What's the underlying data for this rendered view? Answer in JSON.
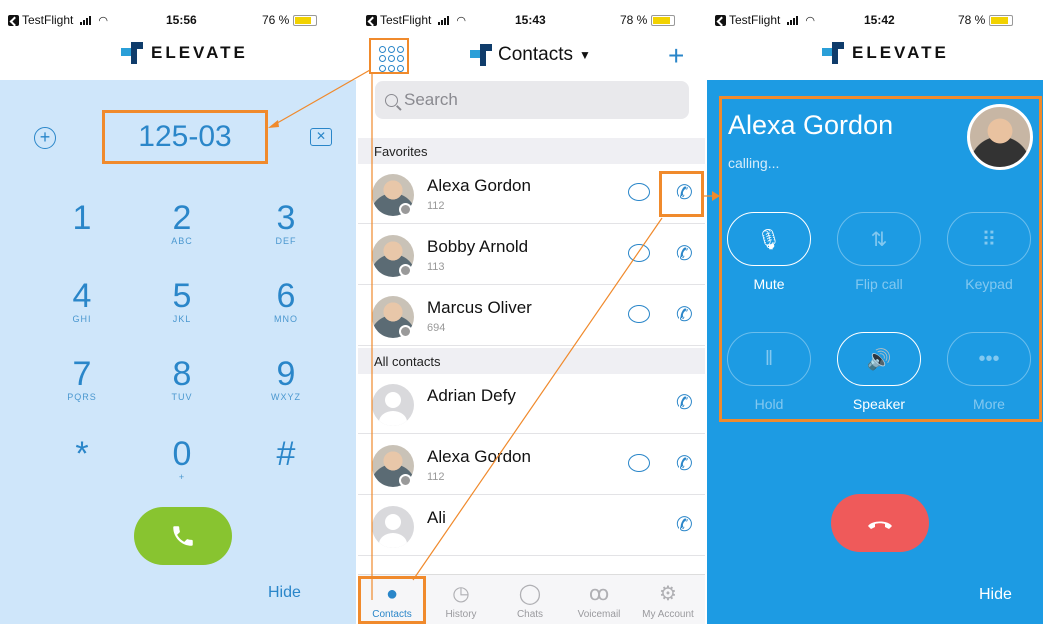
{
  "colors": {
    "accent": "#2a86c9",
    "highlight": "#f08a2c",
    "call_green": "#88c430",
    "hangup_red": "#ef5a5a",
    "call_bg": "#1d9be3"
  },
  "panels": [
    {
      "status": {
        "app": "TestFlight",
        "time": "15:56",
        "battery": "76 %",
        "battery_level": 0.76
      }
    },
    {
      "status": {
        "app": "TestFlight",
        "time": "15:43",
        "battery": "78 %",
        "battery_level": 0.78
      }
    },
    {
      "status": {
        "app": "TestFlight",
        "time": "15:42",
        "battery": "78 %",
        "battery_level": 0.78
      }
    }
  ],
  "brand": {
    "name": "ELEVATE"
  },
  "dialpad": {
    "number": "125-03",
    "keys": [
      {
        "digit": "1",
        "letters": ""
      },
      {
        "digit": "2",
        "letters": "ABC"
      },
      {
        "digit": "3",
        "letters": "DEF"
      },
      {
        "digit": "4",
        "letters": "GHI"
      },
      {
        "digit": "5",
        "letters": "JKL"
      },
      {
        "digit": "6",
        "letters": "MNO"
      },
      {
        "digit": "7",
        "letters": "PQRS"
      },
      {
        "digit": "8",
        "letters": "TUV"
      },
      {
        "digit": "9",
        "letters": "WXYZ"
      },
      {
        "digit": "*",
        "letters": ""
      },
      {
        "digit": "0",
        "letters": "+"
      },
      {
        "digit": "#",
        "letters": ""
      }
    ],
    "hide_label": "Hide"
  },
  "contacts": {
    "title": "Contacts",
    "search_placeholder": "Search",
    "favorites_label": "Favorites",
    "all_label": "All contacts",
    "favorites": [
      {
        "name": "Alexa Gordon",
        "ext": "112",
        "chat": true
      },
      {
        "name": "Bobby Arnold",
        "ext": "113",
        "chat": true
      },
      {
        "name": "Marcus Oliver",
        "ext": "694",
        "chat": true
      }
    ],
    "all": [
      {
        "name": "Adrian Defy",
        "ext": "",
        "chat": false
      },
      {
        "name": "Alexa Gordon",
        "ext": "112",
        "chat": true
      },
      {
        "name": "Ali",
        "ext": "",
        "chat": false
      }
    ],
    "tabs": [
      {
        "label": "Contacts",
        "icon": "person-icon"
      },
      {
        "label": "History",
        "icon": "clock-icon"
      },
      {
        "label": "Chats",
        "icon": "chat-bubble-icon"
      },
      {
        "label": "Voicemail",
        "icon": "voicemail-icon"
      },
      {
        "label": "My Account",
        "icon": "gear-icon"
      }
    ]
  },
  "call": {
    "caller": "Alexa Gordon",
    "status": "calling...",
    "buttons": [
      {
        "label": "Mute",
        "active": true,
        "icon": "microphone-mute-icon"
      },
      {
        "label": "Flip call",
        "active": false,
        "icon": "flip-call-icon"
      },
      {
        "label": "Keypad",
        "active": false,
        "icon": "keypad-icon"
      },
      {
        "label": "Hold",
        "active": false,
        "icon": "pause-icon"
      },
      {
        "label": "Speaker",
        "active": true,
        "icon": "speaker-icon"
      },
      {
        "label": "More",
        "active": false,
        "icon": "more-dots-icon"
      }
    ],
    "hide_label": "Hide"
  }
}
